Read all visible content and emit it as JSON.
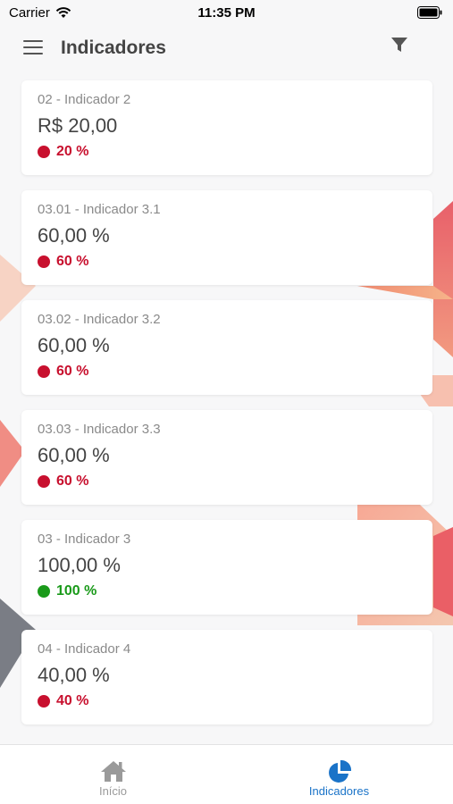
{
  "status_bar": {
    "carrier": "Carrier",
    "time": "11:35 PM"
  },
  "header": {
    "title": "Indicadores",
    "menu_icon": "hamburger-menu-icon",
    "filter_icon": "filter-icon"
  },
  "colors": {
    "red": "#c8102e",
    "green": "#1a9a1a",
    "accent": "#1a73c8"
  },
  "indicators": [
    {
      "name": "02 - Indicador 2",
      "value": "R$ 20,00",
      "percent": "20 %",
      "status": "red"
    },
    {
      "name": "03.01 - Indicador 3.1",
      "value": "60,00 %",
      "percent": "60 %",
      "status": "red"
    },
    {
      "name": "03.02 - Indicador 3.2",
      "value": "60,00 %",
      "percent": "60 %",
      "status": "red"
    },
    {
      "name": "03.03 - Indicador 3.3",
      "value": "60,00 %",
      "percent": "60 %",
      "status": "red"
    },
    {
      "name": "03 - Indicador 3",
      "value": "100,00 %",
      "percent": "100 %",
      "status": "green"
    },
    {
      "name": "04 - Indicador 4",
      "value": "40,00 %",
      "percent": "40 %",
      "status": "red"
    }
  ],
  "tabs": [
    {
      "label": "Início",
      "icon": "home-icon",
      "active": false
    },
    {
      "label": "Indicadores",
      "icon": "pie-chart-icon",
      "active": true
    }
  ]
}
